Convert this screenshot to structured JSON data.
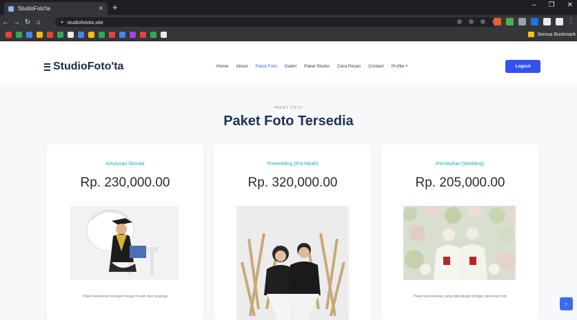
{
  "browser": {
    "tab_title": "StudioFoto'ta",
    "tab_close": "✕",
    "new_tab": "+",
    "window_controls": [
      "–",
      "❐",
      "✕"
    ],
    "address": "studiofotota.site",
    "bookmark_folder": "Semua Bookmark",
    "extension_colors": [
      "#e0632e",
      "#4caf50",
      "#9aa0a6",
      "#1a73e8",
      "#e8eaed",
      "#e8eaed"
    ],
    "bookmark_colors": [
      "#ea4335",
      "#34a853",
      "#4285f4",
      "#fbbc05",
      "#ea4335",
      "#34a853",
      "#e8eaed",
      "#4285f4",
      "#fbbc05",
      "#34a853",
      "#ea4335",
      "#4285f4",
      "#a142f4",
      "#ea4335",
      "#34a853",
      "#e8eaed"
    ]
  },
  "header": {
    "logo_text": "StudioFoto'ta",
    "nav": [
      "Home",
      "About",
      "Paket Foto",
      "Galeri",
      "Paket Studio",
      "Cara Pesan",
      "Contact",
      "Profile ˅"
    ],
    "active_nav": "Paket Foto",
    "login_label": "Logout"
  },
  "section": {
    "eyebrow": "PAKET FOTO",
    "title": "Paket Foto Tersedia"
  },
  "cards": [
    {
      "category": "Kelulusan Wisuda",
      "price": "Rp. 230,000.00",
      "description": "Paket kelulusan dengan harga murah dan lengkap",
      "image_subject": "graduation-photo"
    },
    {
      "category": "Prewedding (Pra Nikah)",
      "price": "Rp. 320,000.00",
      "description": "",
      "image_subject": "prewedding-photo"
    },
    {
      "category": "Pernikahan (Wedding)",
      "price": "Rp. 205,000.00",
      "description": "Paket pernikahan yang dilengkapi dengan dekorasi foto",
      "image_subject": "wedding-photo"
    }
  ],
  "colors": {
    "accent": "#3b6cf0",
    "category": "#12b3a8",
    "title": "#1c3353"
  }
}
